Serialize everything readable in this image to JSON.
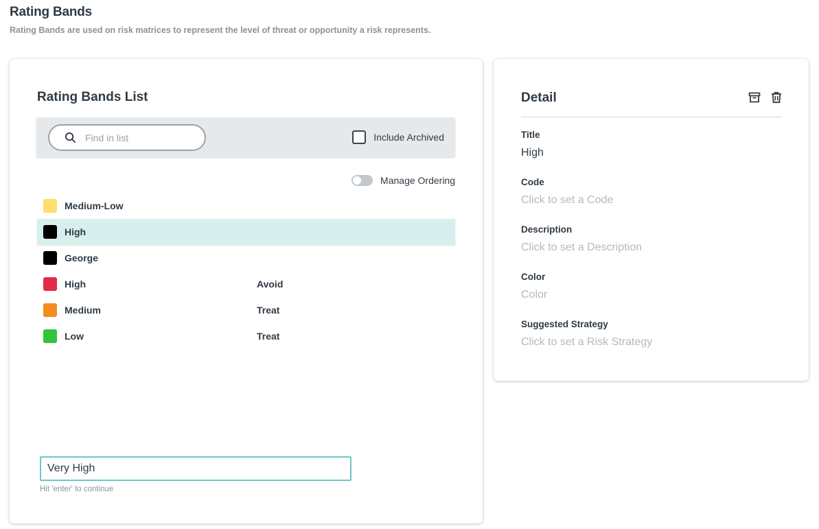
{
  "header": {
    "title": "Rating Bands",
    "subtitle": "Rating Bands are used on risk matrices to represent the level of threat or opportunity a risk represents."
  },
  "list": {
    "title": "Rating Bands List",
    "search_placeholder": "Find in list",
    "include_archived_label": "Include Archived",
    "manage_ordering_label": "Manage Ordering",
    "items": [
      {
        "name": "Medium-Low",
        "strategy": "",
        "color": "#ffdf6b",
        "selected": false
      },
      {
        "name": "High",
        "strategy": "",
        "color": "#000000",
        "selected": true
      },
      {
        "name": "George",
        "strategy": "",
        "color": "#000000",
        "selected": false
      },
      {
        "name": "High",
        "strategy": "Avoid",
        "color": "#e3294a",
        "selected": false
      },
      {
        "name": "Medium",
        "strategy": "Treat",
        "color": "#f58a1f",
        "selected": false
      },
      {
        "name": "Low",
        "strategy": "Treat",
        "color": "#33c43c",
        "selected": false
      }
    ],
    "new_item_value": "Very High",
    "new_item_hint": "Hit 'enter' to continue"
  },
  "detail": {
    "title": "Detail",
    "fields": [
      {
        "label": "Title",
        "value": "High",
        "is_placeholder": false
      },
      {
        "label": "Code",
        "value": "Click to set a Code",
        "is_placeholder": true
      },
      {
        "label": "Description",
        "value": "Click to set a Description",
        "is_placeholder": true
      },
      {
        "label": "Color",
        "value": "Color",
        "is_placeholder": true
      },
      {
        "label": "Suggested Strategy",
        "value": "Click to set a Risk Strategy",
        "is_placeholder": true
      }
    ]
  }
}
